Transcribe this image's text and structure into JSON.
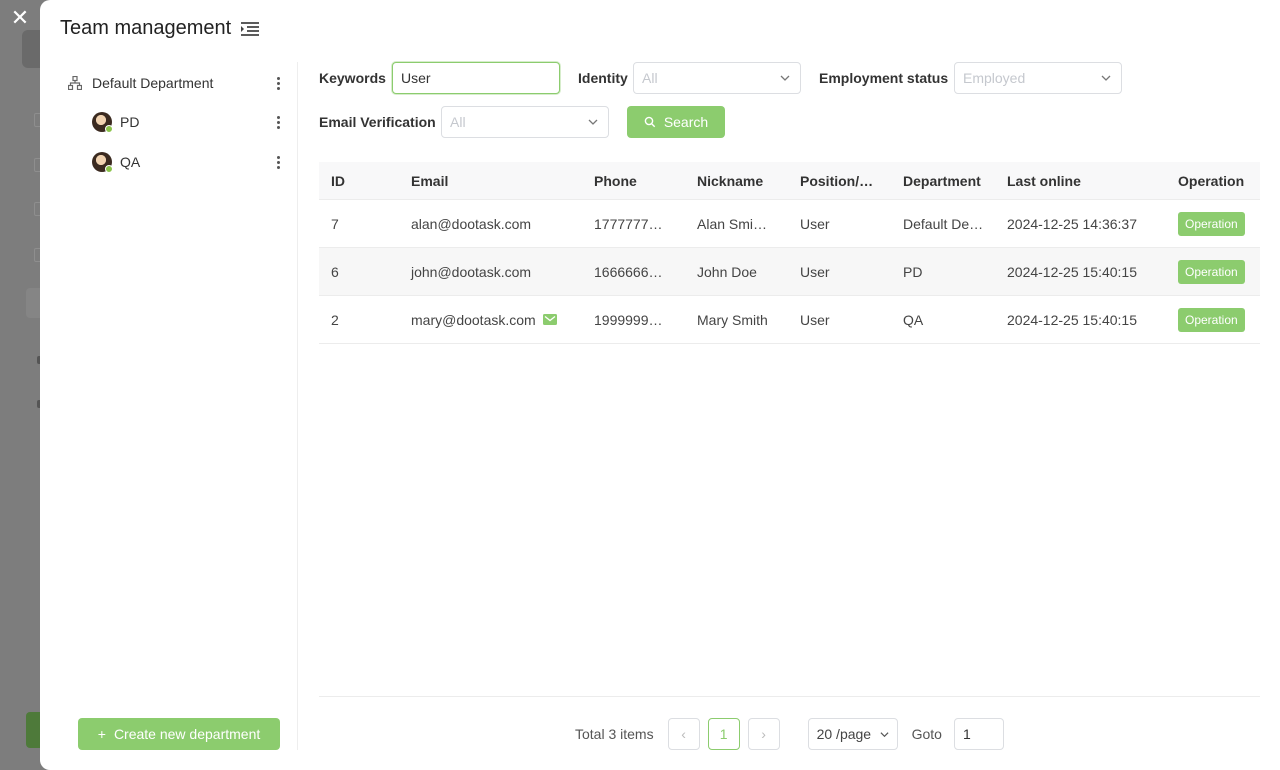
{
  "colors": {
    "accent": "#8ccc6e",
    "header_bg": "#f8f8f9"
  },
  "drawer": {
    "title": "Team management",
    "close_icon": "close-icon",
    "menu_icon": "list-indent-icon"
  },
  "departments": {
    "root": {
      "label": "Default Department",
      "icon": "org-tree-icon"
    },
    "children": [
      {
        "label": "PD"
      },
      {
        "label": "QA"
      }
    ],
    "create_button": "Create new department"
  },
  "filters": {
    "keywords": {
      "label": "Keywords",
      "value": "User"
    },
    "identity": {
      "label": "Identity",
      "placeholder": "All"
    },
    "employment": {
      "label": "Employment status",
      "placeholder": "Employed"
    },
    "email_verification": {
      "label": "Email Verification",
      "placeholder": "All"
    },
    "search_button": "Search"
  },
  "table": {
    "columns": [
      "ID",
      "Email",
      "Phone",
      "Nickname",
      "Position/…",
      "Department",
      "Last online",
      "Operation"
    ],
    "rows": [
      {
        "id": "7",
        "email": "alan@dootask.com",
        "verified": false,
        "phone": "1777777…",
        "nickname": "Alan Smi…",
        "position": "User",
        "department": "Default De…",
        "last_online": "2024-12-25 14:36:37",
        "operation": "Operation"
      },
      {
        "id": "6",
        "email": "john@dootask.com",
        "verified": false,
        "phone": "1666666…",
        "nickname": "John Doe",
        "position": "User",
        "department": "PD",
        "last_online": "2024-12-25 15:40:15",
        "operation": "Operation"
      },
      {
        "id": "2",
        "email": "mary@dootask.com",
        "verified": true,
        "phone": "1999999…",
        "nickname": "Mary Smith",
        "position": "User",
        "department": "QA",
        "last_online": "2024-12-25 15:40:15",
        "operation": "Operation"
      }
    ]
  },
  "pagination": {
    "total": "Total 3 items",
    "current_page": "1",
    "page_size": "20 /page",
    "goto_label": "Goto",
    "goto_value": "1",
    "prev": "‹",
    "next": "›"
  }
}
